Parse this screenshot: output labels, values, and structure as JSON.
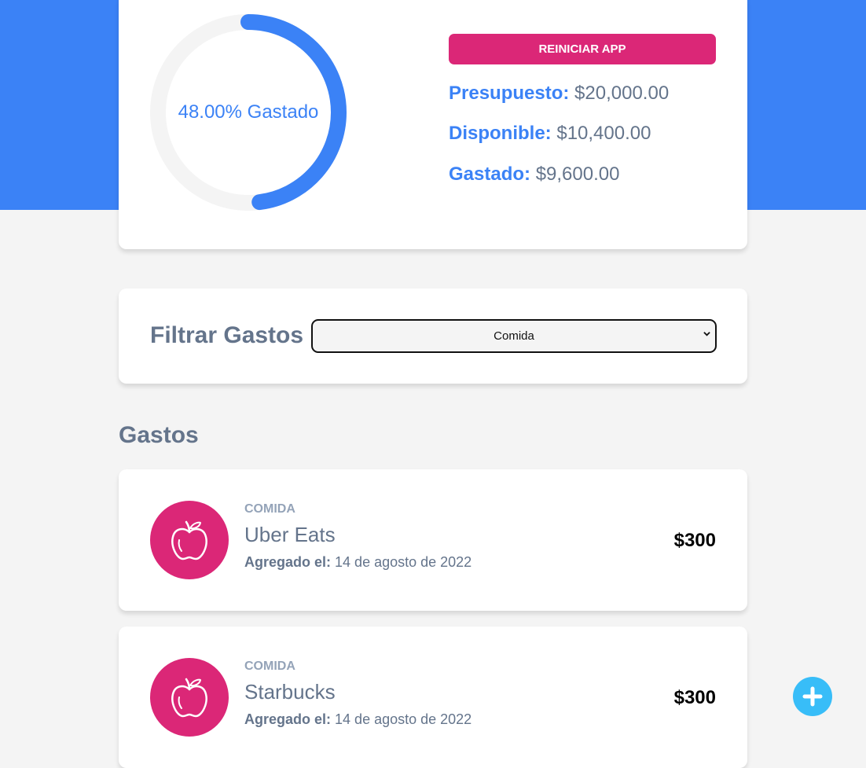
{
  "budget": {
    "progress_percent": 48,
    "progress_text": "48.00% Gastado",
    "reset_label": "Reiniciar app",
    "presupuesto_label": "Presupuesto:",
    "presupuesto_value": "$20,000.00",
    "disponible_label": "Disponible:",
    "disponible_value": "$10,400.00",
    "gastado_label": "Gastado:",
    "gastado_value": "$9,600.00"
  },
  "filter": {
    "label": "Filtrar Gastos",
    "selected": "Comida"
  },
  "expenses_title": "Gastos",
  "expenses": [
    {
      "category": "Comida",
      "icon": "apple-icon",
      "name": "Uber Eats",
      "date_label": "Agregado el:",
      "date": "14 de agosto de 2022",
      "amount": "$300"
    },
    {
      "category": "Comida",
      "icon": "apple-icon",
      "name": "Starbucks",
      "date_label": "Agregado el:",
      "date": "14 de agosto de 2022",
      "amount": "$300"
    }
  ],
  "colors": {
    "primary": "#3b82f6",
    "accent": "#db2777",
    "fab": "#38bdf8",
    "text": "#64748b"
  },
  "fab_icon": "plus-icon"
}
